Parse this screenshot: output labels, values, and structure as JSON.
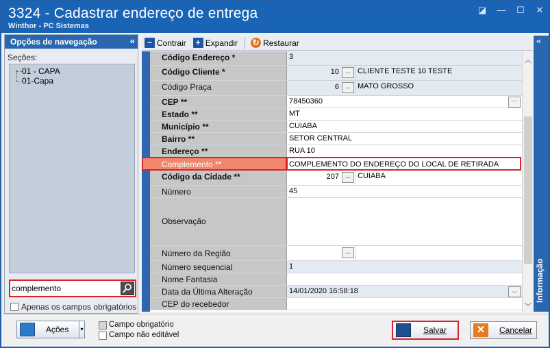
{
  "window": {
    "title": "3324 - Cadastrar endereço de entrega",
    "subtitle": "Winthor - PC Sistemas"
  },
  "nav": {
    "header": "Opções de navegação",
    "collapse": "«",
    "sections_label": "Seções:",
    "tree": [
      "01 - CAPA",
      "01-Capa"
    ],
    "search_value": "complemento",
    "only_required_label": "Apenas os campos obrigatórios"
  },
  "toolbar": {
    "collapse": "Contrair",
    "expand": "Expandir",
    "restore": "Restaurar"
  },
  "fields": [
    {
      "label": "Código Endereço *",
      "value": "3"
    },
    {
      "label": "Código Cliente  *",
      "code": "10",
      "desc": "CLIENTE TESTE 10 TESTE"
    },
    {
      "label": "Código Praça",
      "code": "6",
      "desc": "MATO GROSSO"
    },
    {
      "label": "CEP **",
      "value": "78450360"
    },
    {
      "label": "Estado **",
      "value": "MT"
    },
    {
      "label": "Município **",
      "value": "CUIABA"
    },
    {
      "label": "Bairro **",
      "value": "SETOR CENTRAL"
    },
    {
      "label": "Endereço **",
      "value": "RUA 10"
    },
    {
      "label": "Complemento **",
      "value": "COMPLEMENTO DO ENDEREÇO DO LOCAL DE RETIRADA"
    },
    {
      "label": "Código da Cidade **",
      "code": "207",
      "desc": "CUIABA"
    },
    {
      "label": "Número",
      "value": "45"
    },
    {
      "label": "Observação",
      "value": ""
    },
    {
      "label": "Número da Região",
      "value": ""
    },
    {
      "label": "Número sequencial",
      "value": "1"
    },
    {
      "label": "Nome Fantasia",
      "value": ""
    },
    {
      "label": "Data da Última Alteração",
      "value": "14/01/2020 16:58:18"
    },
    {
      "label": "CEP do recebedor",
      "value": ""
    }
  ],
  "info_panel": {
    "label": "Informação",
    "collapse": "«"
  },
  "bottom": {
    "actions": "Ações",
    "legend_required": "Campo obrigatório",
    "legend_readonly": "Campo não editável",
    "save": "Salvar",
    "cancel": "Cancelar"
  }
}
